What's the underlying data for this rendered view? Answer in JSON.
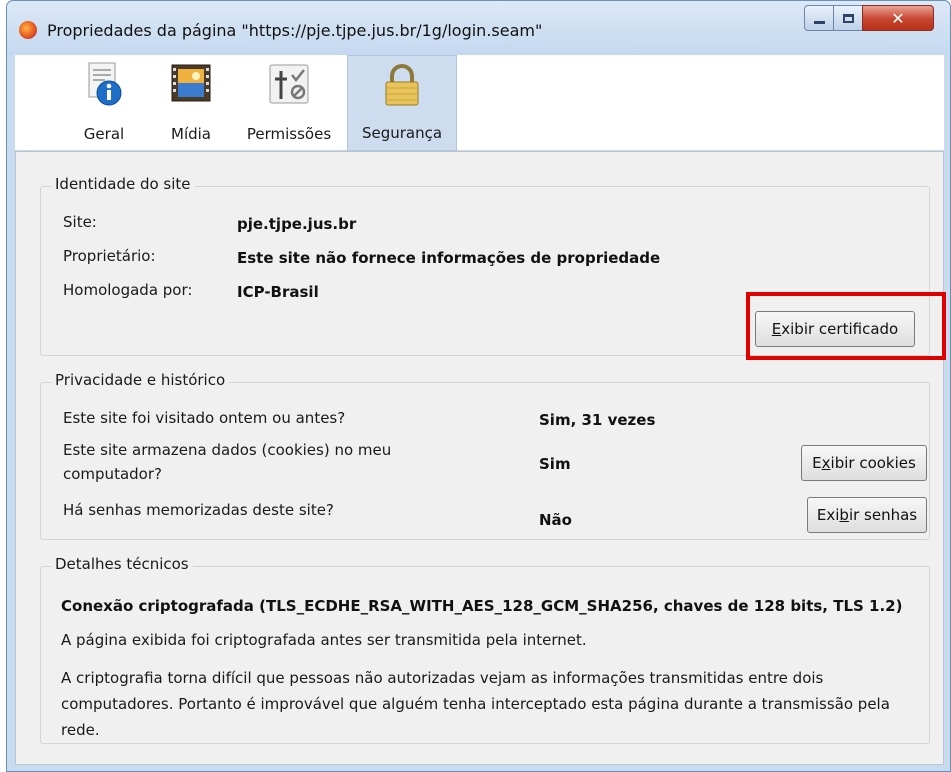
{
  "window": {
    "title": "Propriedades da página \"https://pje.tjpe.jus.br/1g/login.seam\""
  },
  "tabs": [
    {
      "label": "Geral",
      "icon": "info-icon",
      "active": false
    },
    {
      "label": "Mídia",
      "icon": "media-icon",
      "active": false
    },
    {
      "label": "Permissões",
      "icon": "permissions-icon",
      "active": false
    },
    {
      "label": "Segurança",
      "icon": "lock-icon",
      "active": true
    }
  ],
  "identity": {
    "heading": "Identidade do site",
    "site_label": "Site:",
    "site_value": "pje.tjpe.jus.br",
    "owner_label": "Proprietário:",
    "owner_value": "Este site não fornece informações de propriedade",
    "verified_label": "Homologada por:",
    "verified_value": "ICP-Brasil",
    "view_cert_button": {
      "accel": "E",
      "rest": "xibir certificado"
    }
  },
  "privacy": {
    "heading": "Privacidade e histórico",
    "visited_q": "Este site foi visitado ontem ou antes?",
    "visited_a": "Sim, 31 vezes",
    "cookies_q_line1": "Este site armazena dados (cookies) no meu",
    "cookies_q_line2": "computador?",
    "cookies_a": "Sim",
    "cookies_button": {
      "before": "E",
      "accel": "x",
      "after": "ibir cookies"
    },
    "passwords_q": "Há senhas memorizadas deste site?",
    "passwords_a": "Não",
    "passwords_button": {
      "before": "Exi",
      "accel": "b",
      "after": "ir senhas"
    }
  },
  "technical": {
    "heading": "Detalhes técnicos",
    "connection": "Conexão criptografada (TLS_ECDHE_RSA_WITH_AES_128_GCM_SHA256, chaves de 128 bits, TLS 1.2)",
    "line1": "A página exibida foi criptografada antes ser transmitida pela internet.",
    "line2": "A criptografia torna difícil que pessoas não autorizadas vejam as informações transmitidas entre dois computadores. Portanto é improvável que alguém tenha interceptado esta página durante a transmissão pela rede."
  },
  "colors": {
    "highlight": "#e00000",
    "active_tab": "#cddcee",
    "close_button": "#c7452f"
  }
}
